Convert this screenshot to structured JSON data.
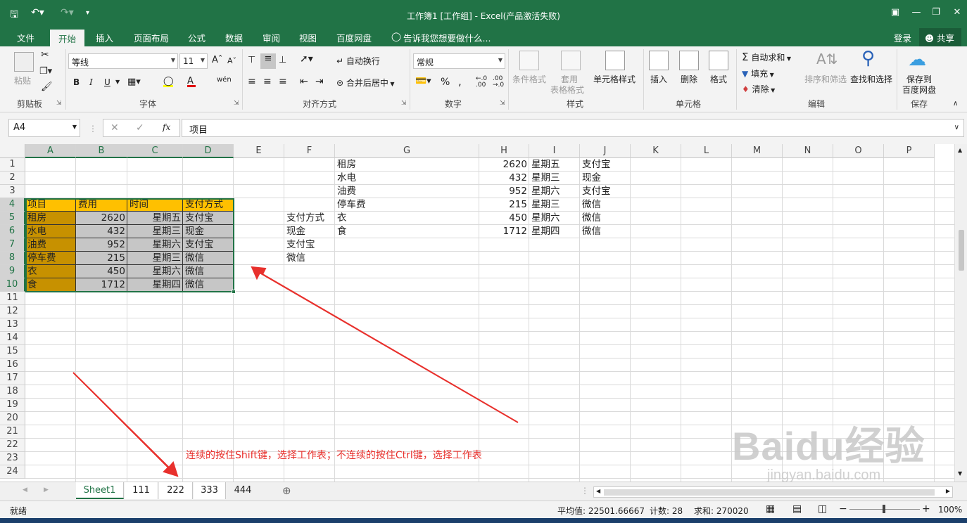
{
  "window": {
    "title": "工作簿1  [工作组] - Excel(产品激活失败)",
    "min_icon": "minimize-icon",
    "max_icon": "restore-icon",
    "close_icon": "close-icon"
  },
  "tabs": [
    {
      "label": "文件"
    },
    {
      "label": "开始"
    },
    {
      "label": "插入"
    },
    {
      "label": "页面布局"
    },
    {
      "label": "公式"
    },
    {
      "label": "数据"
    },
    {
      "label": "审阅"
    },
    {
      "label": "视图"
    },
    {
      "label": "百度网盘"
    },
    {
      "label": "告诉我您想要做什么..."
    }
  ],
  "account": {
    "login": "登录",
    "share": "共享"
  },
  "ribbon": {
    "clipboard": {
      "paste": "粘贴",
      "group": "剪贴板"
    },
    "font": {
      "name": "等线",
      "size": "11",
      "bold": "B",
      "italic": "I",
      "underline": "U",
      "group": "字体"
    },
    "align": {
      "wrap": "自动换行",
      "merge": "合并后居中",
      "group": "对齐方式"
    },
    "number": {
      "format": "常规",
      "percent": "%",
      "comma": ",",
      "group": "数字"
    },
    "styles": {
      "cond": "条件格式",
      "table": "套用",
      "table2": "表格格式",
      "cell": "单元格样式",
      "group": "样式"
    },
    "cells": {
      "insert": "插入",
      "delete": "删除",
      "format": "格式",
      "group": "单元格"
    },
    "edit": {
      "autosum": "自动求和",
      "fill": "填充",
      "clear": "清除",
      "sort": "排序和筛选",
      "find": "查找和选择",
      "group": "编辑"
    },
    "save": {
      "label": "保存到",
      "label2": "百度网盘",
      "group": "保存"
    }
  },
  "formula_bar": {
    "name_box": "A4",
    "fx": "fx",
    "value": "项目"
  },
  "columns": [
    "A",
    "B",
    "C",
    "D",
    "E",
    "F",
    "G",
    "H",
    "I",
    "J",
    "K",
    "L",
    "M",
    "N",
    "O",
    "P"
  ],
  "rows": [
    "1",
    "2",
    "3",
    "4",
    "5",
    "6",
    "7",
    "8",
    "9",
    "10",
    "11",
    "12",
    "13",
    "14",
    "15",
    "16",
    "17",
    "18",
    "19",
    "20",
    "21",
    "22",
    "23",
    "24"
  ],
  "table_a": {
    "header": [
      "项目",
      "费用",
      "时间",
      "支付方式"
    ],
    "rows": [
      [
        "租房",
        "2620",
        "星期五",
        "支付宝"
      ],
      [
        "水电",
        "432",
        "星期三",
        "现金"
      ],
      [
        "油费",
        "952",
        "星期六",
        "支付宝"
      ],
      [
        "停车费",
        "215",
        "星期三",
        "微信"
      ],
      [
        "衣",
        "450",
        "星期六",
        "微信"
      ],
      [
        "食",
        "1712",
        "星期四",
        "微信"
      ]
    ]
  },
  "col_f": [
    "支付方式",
    "现金",
    "支付宝",
    "微信"
  ],
  "table_g": [
    [
      "租房",
      "2620",
      "星期五",
      "支付宝"
    ],
    [
      "水电",
      "432",
      "星期三",
      "现金"
    ],
    [
      "油费",
      "952",
      "星期六",
      "支付宝"
    ],
    [
      "停车费",
      "215",
      "星期三",
      "微信"
    ],
    [
      "衣",
      "450",
      "星期六",
      "微信"
    ],
    [
      "食",
      "1712",
      "星期四",
      "微信"
    ]
  ],
  "annotation": "连续的按住Shift键，选择工作表；不连续的按住Ctrl键，选择工作表",
  "sheets": [
    {
      "label": "Sheet1"
    },
    {
      "label": "111"
    },
    {
      "label": "222"
    },
    {
      "label": "333"
    },
    {
      "label": "444"
    }
  ],
  "status": {
    "ready": "就绪",
    "average": "平均值: 22501.66667",
    "count": "计数: 28",
    "sum": "求和: 270020",
    "zoom": "100%"
  },
  "watermark": {
    "line1": "Baidu经验",
    "line2": "jingyan.baidu.com"
  },
  "colors": {
    "excel_green": "#217346",
    "header_fill": "#ffc000",
    "row_fill": "#c79100",
    "arrow": "#e8302c"
  }
}
